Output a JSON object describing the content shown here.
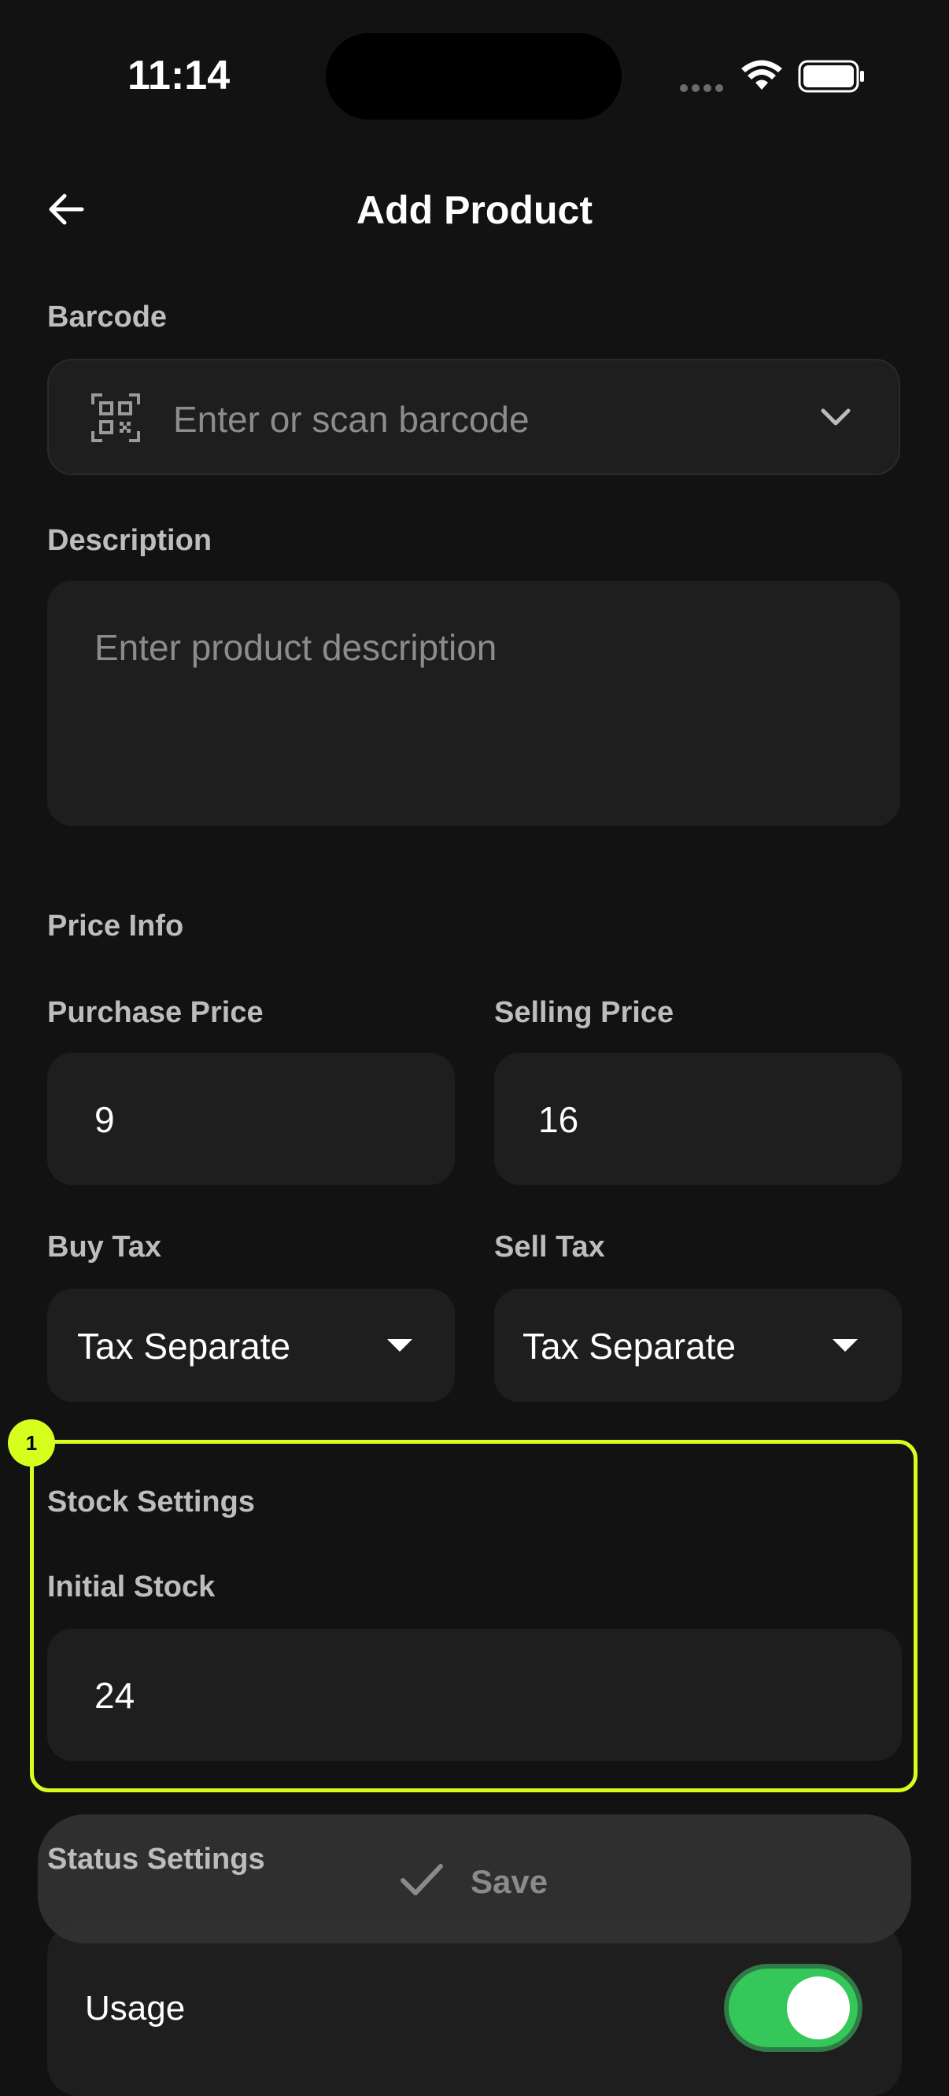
{
  "status_bar": {
    "time": "11:14"
  },
  "header": {
    "title": "Add Product"
  },
  "barcode": {
    "label": "Barcode",
    "placeholder": "Enter or scan barcode"
  },
  "description": {
    "label": "Description",
    "placeholder": "Enter product description"
  },
  "price_info": {
    "section_label": "Price Info",
    "purchase_price": {
      "label": "Purchase Price",
      "value": "9"
    },
    "selling_price": {
      "label": "Selling Price",
      "value": "16"
    },
    "buy_tax": {
      "label": "Buy Tax",
      "selected": "Tax Separate"
    },
    "sell_tax": {
      "label": "Sell Tax",
      "selected": "Tax Separate"
    }
  },
  "stock_settings": {
    "badge": "1",
    "section_label": "Stock Settings",
    "initial_stock": {
      "label": "Initial Stock",
      "value": "24"
    }
  },
  "status_settings": {
    "section_label": "Status Settings",
    "usage_label": "Usage",
    "usage_enabled": true
  },
  "save_button": {
    "label": "Save"
  },
  "colors": {
    "background": "#121212",
    "field": "#1e1e1e",
    "highlight": "#d6ff1e",
    "toggle_on": "#35c759"
  }
}
